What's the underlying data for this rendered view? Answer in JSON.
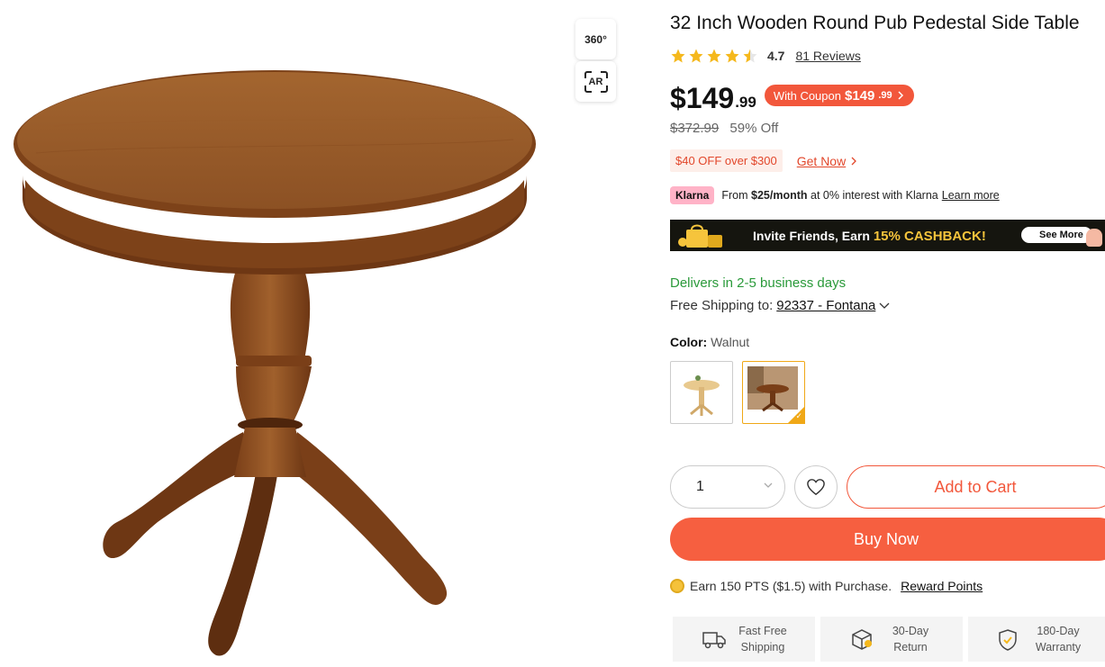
{
  "media": {
    "btn_360": "360°",
    "btn_ar": "AR"
  },
  "product": {
    "title": "32 Inch Wooden Round Pub Pedestal Side Table",
    "rating": "4.7",
    "stars": 4.5,
    "reviews_label": "81 Reviews",
    "price_main": "$149",
    "price_cents": ".99",
    "coupon_prefix": "With Coupon",
    "coupon_price_main": "$149",
    "coupon_price_cents": ".99",
    "original_price": "$372.99",
    "discount": "59% Off",
    "promo_tag": "$40 OFF over $300",
    "promo_link": "Get Now",
    "klarna_logo": "Klarna",
    "klarna_prefix": "From",
    "klarna_amount": "$25/month",
    "klarna_suffix": "at 0% interest with Klarna",
    "klarna_link": "Learn more"
  },
  "banner": {
    "text": "Invite Friends, Earn",
    "highlight": "15% CASHBACK!",
    "button": "See More"
  },
  "shipping": {
    "delivery": "Delivers in 2-5 business days",
    "ship_label": "Free Shipping to:",
    "location": "92337 - Fontana"
  },
  "color": {
    "label": "Color:",
    "value": "Walnut",
    "options": [
      "Natural",
      "Walnut"
    ],
    "selected": "Walnut"
  },
  "cart": {
    "quantity": "1",
    "add_to_cart": "Add to Cart",
    "buy_now": "Buy Now"
  },
  "points": {
    "text": "Earn 150 PTS ($1.5) with Purchase.",
    "link": "Reward Points"
  },
  "features": [
    {
      "line1": "Fast Free",
      "line2": "Shipping"
    },
    {
      "line1": "30-Day",
      "line2": "Return"
    },
    {
      "line1": "180-Day",
      "line2": "Warranty"
    }
  ],
  "colors": {
    "accent": "#f2573b",
    "buy_now": "#f65f40",
    "delivery_green": "#2a9a3a",
    "star": "#f5b81c",
    "swatch_selected": "#f0a817"
  }
}
